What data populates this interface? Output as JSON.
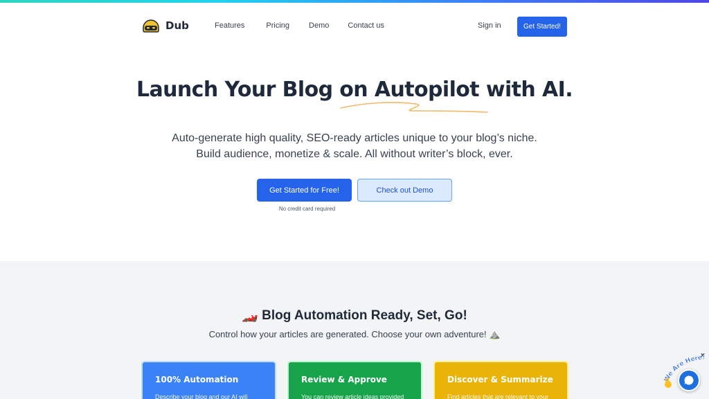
{
  "nav": {
    "brand": "Dub",
    "links": [
      "Features",
      "Pricing",
      "Demo",
      "Contact us"
    ],
    "sign_in": "Sign in",
    "cta": "Get Started!"
  },
  "hero": {
    "title": "Launch Your Blog on Autopilot with AI.",
    "subtitle_line1": "Auto-generate high quality, SEO-ready articles unique to your blog’s niche.",
    "subtitle_line2": "Build audience, monetize & scale. All without writer’s block, ever.",
    "primary_cta": "Get Started for Free!",
    "secondary_cta": "Check out Demo",
    "note": "No credit card required"
  },
  "section": {
    "title": "🏎️ Blog Automation Ready, Set, Go!",
    "subtitle": "Control how your articles are generated. Choose your own adventure! ⛰️",
    "cards": [
      {
        "title": "100% Automation",
        "desc": "Describe your blog and our AI will",
        "color": "#3b82f6"
      },
      {
        "title": "Review & Approve",
        "desc": "You can review article ideas provided",
        "color": "#16a34a"
      },
      {
        "title": "Discover & Summarize",
        "desc": "Find articles that are relevant to your",
        "color": "#eab308"
      }
    ]
  },
  "chat": {
    "badge_text": "We Are Here!",
    "close": "×"
  },
  "colors": {
    "accent": "#2563eb",
    "highlight": "#f0b96b"
  }
}
